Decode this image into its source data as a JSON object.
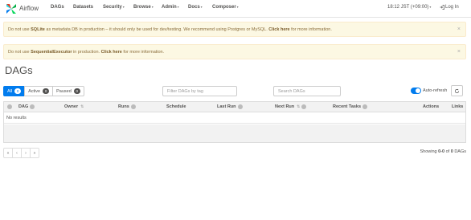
{
  "navbar": {
    "brand": "Airflow",
    "items": [
      {
        "label": "DAGs",
        "dropdown": false
      },
      {
        "label": "Datasets",
        "dropdown": false
      },
      {
        "label": "Security",
        "dropdown": true
      },
      {
        "label": "Browse",
        "dropdown": true
      },
      {
        "label": "Admin",
        "dropdown": true
      },
      {
        "label": "Docs",
        "dropdown": true
      },
      {
        "label": "Composer",
        "dropdown": true
      }
    ],
    "clock": "18:12 JST (+09:00)",
    "login": "Log In"
  },
  "alerts": [
    {
      "pre": "Do not use ",
      "strong": "SQLite",
      "mid": " as metadata DB in production – it should only be used for dev/testing. We recommend using Postgres or MySQL. ",
      "link": "Click here",
      "post": " for more information."
    },
    {
      "pre": "Do not use ",
      "strong": "SequentialExecutor",
      "mid": " in production. ",
      "link": "Click here",
      "post": " for more information."
    }
  ],
  "page_title": "DAGs",
  "filter_tabs": [
    {
      "label": "All",
      "count": "0",
      "active": true
    },
    {
      "label": "Active",
      "count": "0",
      "active": false
    },
    {
      "label": "Paused",
      "count": "0",
      "active": false
    }
  ],
  "tag_filter": {
    "placeholder": "Filter DAGs by tag"
  },
  "search": {
    "placeholder": "Search DAGs"
  },
  "auto_refresh": {
    "label": "Auto-refresh",
    "enabled": true
  },
  "table": {
    "columns": [
      "DAG",
      "Owner",
      "Runs",
      "Schedule",
      "Last Run",
      "Next Run",
      "Recent Tasks",
      "Actions",
      "Links"
    ],
    "empty_text": "No results"
  },
  "pagination": [
    "«",
    "‹",
    "›",
    "»"
  ],
  "showing": {
    "prefix": "Showing ",
    "range": "0-0",
    "mid": " of ",
    "total": "0",
    "suffix": " DAGs"
  },
  "colors": {
    "accent": "#017cee",
    "alert_bg": "#fcf8e3",
    "alert_text": "#8a6d3b"
  },
  "icons": [
    "airflow-logo-icon",
    "login-icon",
    "close-icon",
    "info-icon",
    "sort-icon",
    "refresh-icon"
  ]
}
